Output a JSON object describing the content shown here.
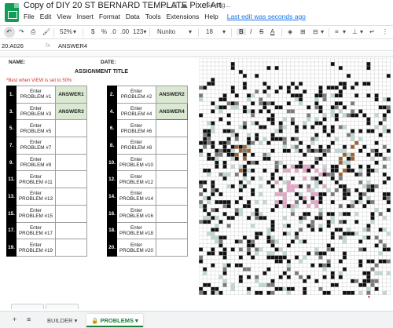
{
  "app": {
    "doc_title": "Copy of DIY 20 ST BERNARD TEMPLATE Pixel Art",
    "save_status": "Saving...",
    "menu": [
      "File",
      "Edit",
      "View",
      "Insert",
      "Format",
      "Data",
      "Tools",
      "Extensions",
      "Help"
    ],
    "last_edit": "Last edit was seconds ago"
  },
  "toolbar": {
    "zoom": "52%",
    "currency": "$",
    "percent": "%",
    "dec_less": ".0",
    "dec_more": ".00",
    "more_formats": "123▾",
    "font": "Nunito",
    "font_size": "18",
    "bold": "B",
    "italic": "I",
    "strike": "S",
    "text_color": "A"
  },
  "formula_bar": {
    "name_box": "20:A026",
    "fx": "fx",
    "value": "ANSWER4"
  },
  "worksheet": {
    "name_label": "NAME:",
    "date_label": "DATE:",
    "assignment_title": "ASSIGNMENT TITLE",
    "hint": "*Best when VIEW is set to 50%",
    "left_problems": [
      {
        "num": "1.",
        "prob": "Enter PROBLEM #1",
        "ans": "ANSWER1"
      },
      {
        "num": "3.",
        "prob": "Enter PROBLEM #3",
        "ans": "ANSWER3"
      },
      {
        "num": "5.",
        "prob": "Enter PROBLEM #5",
        "ans": ""
      },
      {
        "num": "7.",
        "prob": "Enter PROBLEM #7",
        "ans": ""
      },
      {
        "num": "9.",
        "prob": "Enter PROBLEM #9",
        "ans": ""
      },
      {
        "num": "11.",
        "prob": "Enter PROBLEM #11",
        "ans": ""
      },
      {
        "num": "13.",
        "prob": "Enter PROBLEM #13",
        "ans": ""
      },
      {
        "num": "15.",
        "prob": "Enter PROBLEM #15",
        "ans": ""
      },
      {
        "num": "17.",
        "prob": "Enter PROBLEM #17",
        "ans": ""
      },
      {
        "num": "19.",
        "prob": "Enter PROBLEM #19",
        "ans": ""
      }
    ],
    "right_problems": [
      {
        "num": "2.",
        "prob": "Enter PROBLEM #2",
        "ans": "ANSWER2"
      },
      {
        "num": "4.",
        "prob": "Enter PROBLEM #4",
        "ans": "ANSWER4"
      },
      {
        "num": "6.",
        "prob": "Enter PROBLEM #6",
        "ans": ""
      },
      {
        "num": "8.",
        "prob": "Enter PROBLEM #8",
        "ans": ""
      },
      {
        "num": "10.",
        "prob": "Enter PROBLEM #10",
        "ans": ""
      },
      {
        "num": "12.",
        "prob": "Enter PROBLEM #12",
        "ans": ""
      },
      {
        "num": "14.",
        "prob": "Enter PROBLEM #14",
        "ans": ""
      },
      {
        "num": "16.",
        "prob": "Enter PROBLEM #16",
        "ans": ""
      },
      {
        "num": "18.",
        "prob": "Enter PROBLEM #18",
        "ans": ""
      },
      {
        "num": "20.",
        "prob": "Enter PROBLEM #20",
        "ans": ""
      }
    ],
    "pixel_colors": {
      "dark": "#111111",
      "mid": "#7a7a7a",
      "brown": "#a0622d",
      "pink": "#e8a3c8",
      "teal": "#bfd8d2",
      "grid": "#c8c8c8"
    }
  },
  "tabs": {
    "add_icon": "plus-icon",
    "list_icon": "menu-icon",
    "sheets": [
      {
        "label": "BUILDER",
        "active": false
      },
      {
        "label": "PROBLEMS",
        "active": true
      }
    ],
    "dropdown_glyph": "▾",
    "lock_icon": "lock-icon"
  }
}
